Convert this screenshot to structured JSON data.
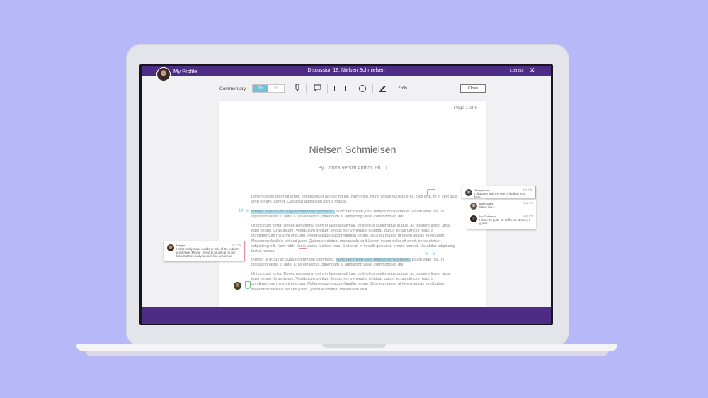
{
  "header": {
    "profile_label": "My Profile",
    "title": "Discussion 18: Nielsen Schmielsen",
    "logout": "Log out",
    "close_glyph": "✕"
  },
  "toolbar": {
    "commentary_label": "Commentary",
    "toggle_on": "On",
    "toggle_off": "Off",
    "zoom": "75%",
    "close_label": "Close"
  },
  "document": {
    "page_indicator": "Page 1 of 6",
    "title": "Nielsen Schmielsen",
    "byline": "By Contra Versial Author, Ph. D",
    "p1": "Lorem ipsum dolor sit amet, consectetuer adipiscing elit. Nam nibh. Nunc varius facilisis eros. Sed erat. In in velit quis arcu ornare laoreet. Curabitur adipiscing luctus massa.",
    "p2_hl": "Integer ut purus ac augue commodo commodo.",
    "p2_rest": " Nunc nec mi eu justo tempor consectetuer. Etiam vitae nisl. In dignissim lacus ut ante. Cras elit lectus, bibendum a, adipiscing vitae, commodo et, dui.",
    "p3": "Ut tincidunt tortor. Donec nonummy, enim in lacinia pulvinar, velit tellus scelerisque augue, ac posuere libero urna eget neque. Cras ipsum. Vestibulum pretium, lectus nec venenatis volutpat, purus lectus ultrices risus, a condimentum risus mi et quam. Pellentesque auctor fringilla neque. Duis eu massa ut lorem iaculis vestibulum. Maecenas facilisis elit sed justo. Quisque volutpat malesuada velit.Lorem ipsum dolor sit amet, consectetuer adipiscing elit. Nam nibh. Nunc varius facilisis eros. Sed erat. In in velit quis arcu ornare laoreet. Curabitur adipiscing luctus massa.",
    "p4_a": "Integer ut purus ac augue commodo commodo. ",
    "p4_hl": "Nunc nec mi eu justo tempor consectetuer.",
    "p4_rest": " Etiam vitae nisl. In dignissim lacus ut ante. Cras elit lectus, bibendum a, adipiscing vitae, commodo et, dui.",
    "p5": "Ut tincidunt tortor. Donec nonummy, enim in lacinia pulvinar, velit tellus scelerisque augue, ac posuere libero urna eget neque. Cras ipsum. Vestibulum pretium, lectus nec venenatis volutpat, purus lectus ultrices risus, a condimentum risus mi et quam. Pellentesque auctor fringilla neque. Duis eu massa ut lorem iaculis vestibulum. Maecenas facilisis elit sed justo. Quisque volutpat malesuada velit.",
    "linenum_1": "14",
    "linenum_2": "6"
  },
  "comments": [
    {
      "name": "Anonymous",
      "time": "3:20 PM",
      "text": "I disagree with the use of facilisis eros here."
    },
    {
      "name": "Mike Dales",
      "time": "3:15 PM",
      "text": "Same here."
    },
    {
      "name": "Ian Coleman",
      "time": "3:00 PM",
      "text": "I think it's quite ok. Different strokes, I guess."
    },
    {
      "name": "Megan",
      "time": "3:23 PM",
      "text": "I can't really make heads or tails of Dr. Author's point here. Maybe I need to brush up on my latin, but this really sounds like nonsense."
    }
  ],
  "colors": {
    "brand": "#4d2c86",
    "highlight": "#a9dff0",
    "accent_pink": "#e58bb5",
    "accent_green": "#69c77a",
    "background": "#b7b8f8"
  },
  "icons": [
    "highlighter-icon",
    "speech-bubble-icon",
    "rectangle-icon",
    "circle-icon",
    "pen-icon",
    "close-icon",
    "pencil-icon",
    "comment-icon",
    "bookmark-icon"
  ]
}
